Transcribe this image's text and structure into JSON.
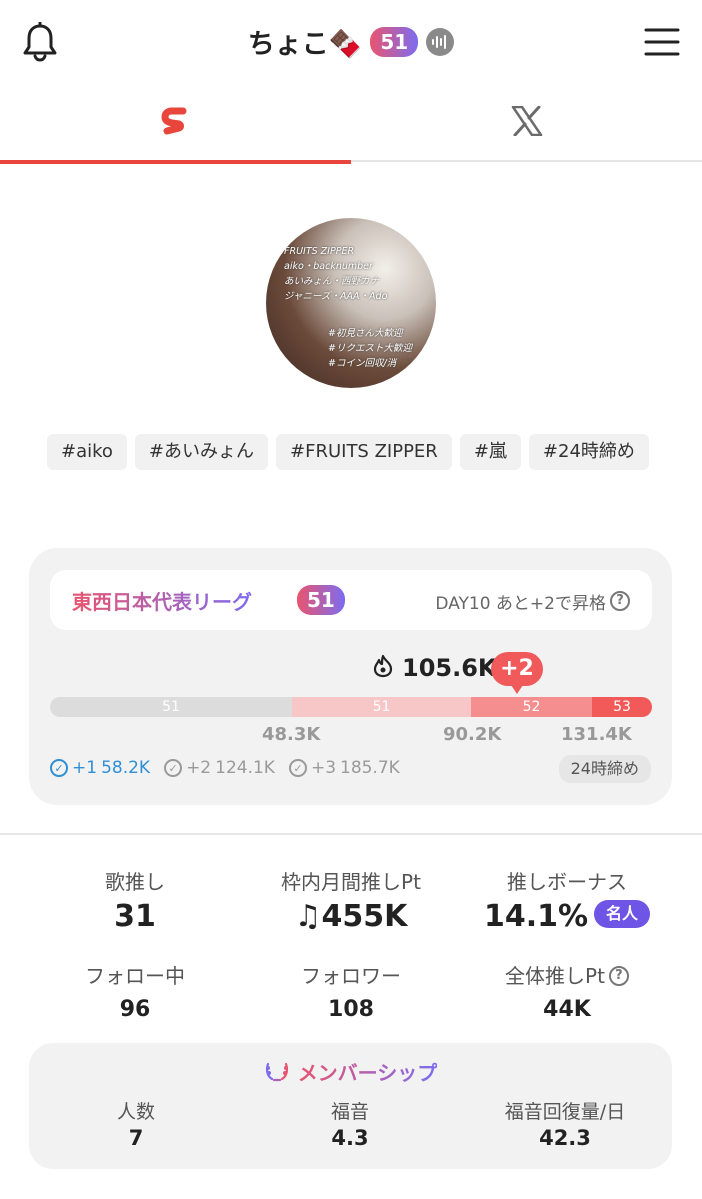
{
  "header": {
    "name": "ちょこ🍫",
    "level": "51",
    "bell_icon": "bell-icon",
    "menu_icon": "hamburger-menu-icon",
    "voice_icon": "waveform-icon"
  },
  "tabs": [
    {
      "id": "showroom",
      "icon": "showroom-s-logo-icon",
      "active": true
    },
    {
      "id": "x",
      "icon": "x-logo-icon",
      "active": false
    }
  ],
  "avatar": {
    "lines_top": [
      "FRUITS ZIPPER",
      "aiko・backnumber",
      "あいみょん・西野カナ",
      "ジャニーズ・AAA・Ado"
    ],
    "lines_bottom": [
      "#初見さん大歓迎",
      "#リクエスト大歓迎",
      "#コイン回収/消"
    ]
  },
  "tags": [
    "#aiko",
    "#あいみょん",
    "#FRUITS ZIPPER",
    "#嵐",
    "#24時締め"
  ],
  "league": {
    "name": "東西日本代表リーグ",
    "level": "51",
    "day_text": "DAY10 あと+2で昇格",
    "score": "105.6K",
    "diff": "+2",
    "progress_fraction": 0.775,
    "segments": [
      {
        "label": "51",
        "color": "#dcdcdc"
      },
      {
        "label": "51",
        "color": "#f7c7c7"
      },
      {
        "label": "52",
        "color": "#f58f8f"
      },
      {
        "label": "53",
        "color": "#f25a5a"
      }
    ],
    "ticks": [
      "48.3K",
      "90.2K",
      "131.4K"
    ],
    "next": [
      {
        "rank": "+1",
        "value": "58.2K",
        "highlight": true
      },
      {
        "rank": "+2",
        "value": "124.1K",
        "highlight": false
      },
      {
        "rank": "+3",
        "value": "185.7K",
        "highlight": false
      }
    ],
    "deadline": "24時締め"
  },
  "stats": {
    "song_oshi": {
      "label": "歌推し",
      "value": "31"
    },
    "monthly_pt": {
      "label": "枠内月間推しPt",
      "value": "455K",
      "icon": "music-note-icon"
    },
    "bonus": {
      "label": "推しボーナス",
      "value": "14.1%",
      "badge": "名人"
    },
    "following": {
      "label": "フォロー中",
      "value": "96"
    },
    "followers": {
      "label": "フォロワー",
      "value": "108"
    },
    "total_pt": {
      "label": "全体推しPt",
      "value": "44K"
    }
  },
  "membership": {
    "title": "メンバーシップ",
    "icon": "laurel-wreath-icon",
    "items": [
      {
        "label": "人数",
        "value": "7"
      },
      {
        "label": "福音",
        "value": "4.3"
      },
      {
        "label": "福音回復量/日",
        "value": "42.3"
      }
    ]
  }
}
